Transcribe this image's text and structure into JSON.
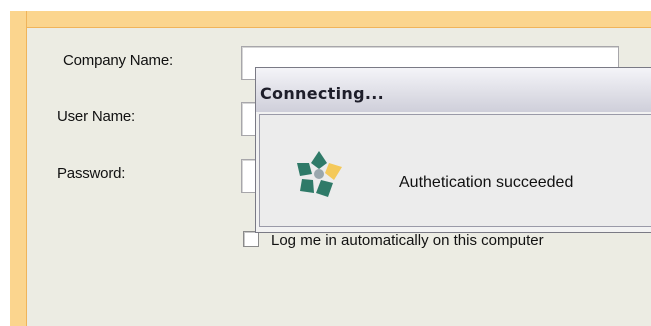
{
  "form": {
    "company_label": "Company Name:",
    "company_value": "",
    "user_label": "User Name:",
    "user_value": "",
    "password_label": "Password:",
    "password_value": "",
    "auto_login_label": "Log me in automatically on this computer",
    "auto_login_checked": false
  },
  "dialog": {
    "title": "Connecting...",
    "message": "Authetication succeeded",
    "icon": "app-logo-icon"
  },
  "colors": {
    "frame": "#fbd58e",
    "panel": "#ecece3",
    "logo_teal": "#2f7a68",
    "logo_yellow": "#f4c95a",
    "logo_gray": "#9aa7ad"
  }
}
